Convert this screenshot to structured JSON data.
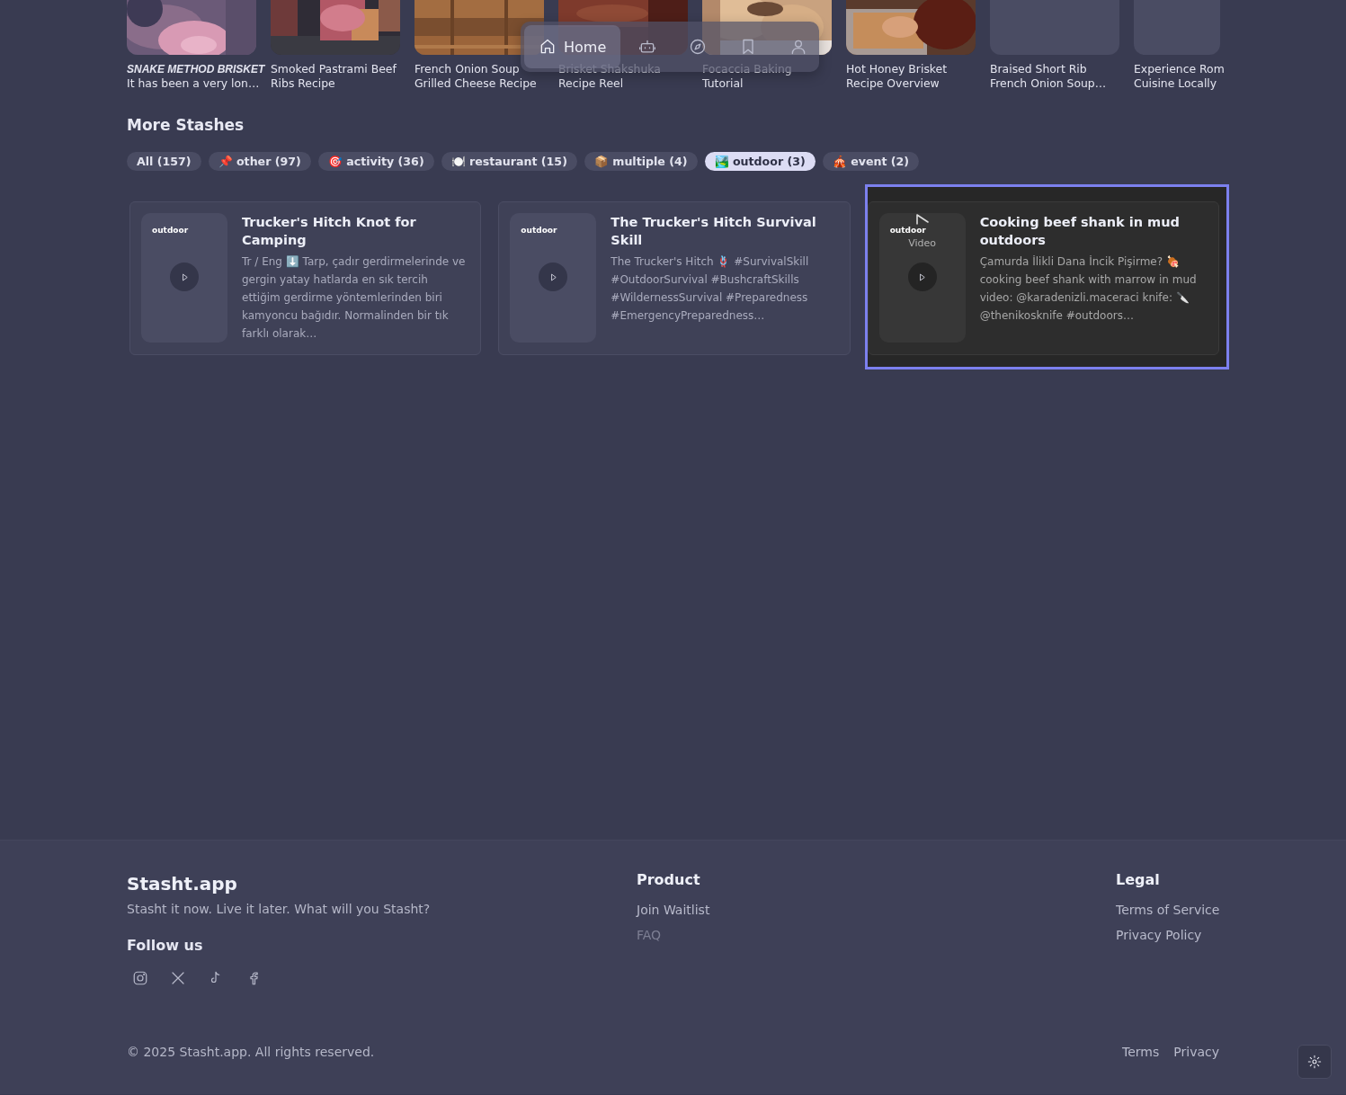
{
  "recent": [
    {
      "kind": "picture",
      "title": "SNAKE METHOD BRISKET",
      "subtitle": "It has been a very lon…"
    },
    {
      "kind": "picture",
      "lines": [
        "Smoked Pastrami Beef",
        "Ribs Recipe"
      ]
    },
    {
      "kind": "picture",
      "lines": [
        "French Onion Soup",
        "Grilled Cheese Recipe"
      ]
    },
    {
      "kind": "picture",
      "lines": [
        "Brisket Shakshuka",
        "Recipe Reel"
      ]
    },
    {
      "kind": "picture",
      "lines": [
        "Focaccia Baking",
        "Tutorial"
      ]
    },
    {
      "kind": "picture",
      "lines": [
        "Hot Honey Brisket",
        "Recipe Overview"
      ]
    },
    {
      "kind": "placeholder",
      "lines": [
        "Braised Short Rib",
        "French Onion Soup…"
      ]
    },
    {
      "kind": "placeholder",
      "lines": [
        "Experience Rom",
        "Cuisine Locally"
      ]
    }
  ],
  "nav": {
    "items": [
      {
        "kind": "home",
        "label": "Home",
        "selected": true
      },
      {
        "kind": "robot",
        "selected": false
      },
      {
        "kind": "compass",
        "selected": false
      },
      {
        "kind": "bookmark",
        "selected": false
      },
      {
        "kind": "user",
        "selected": false
      }
    ]
  },
  "section_title": "More Stashes",
  "filters": [
    {
      "label": "All (157)",
      "selected": false
    },
    {
      "label": "📌 other (97)",
      "selected": false
    },
    {
      "label": "🎯 activity (36)",
      "selected": false
    },
    {
      "label": "🍽️ restaurant (15)",
      "selected": false
    },
    {
      "label": "📦 multiple (4)",
      "selected": false
    },
    {
      "label": "🏞️ outdoor (3)",
      "selected": true
    },
    {
      "label": "🎪 event (2)",
      "selected": false
    }
  ],
  "stashes": [
    {
      "tag": "outdoor",
      "title": "Trucker's Hitch Knot for Camping",
      "description": "Tr / Eng ⬇️ Tarp, çadır gerdirmelerinde ve gergin yatay hatlarda en sık tercih ettiğim gerdirme yöntemlerinden biri kamyoncu bağıdır. Normalinden bir tık farklı olarak…",
      "selected": false
    },
    {
      "tag": "outdoor",
      "title": "The Trucker's Hitch Survival Skill",
      "description": "The Trucker's Hitch 🪢 #SurvivalSkill #OutdoorSurvival #BushcraftSkills #WildernessSurvival #Preparedness #EmergencyPreparedness…",
      "selected": false
    },
    {
      "tag": "outdoor",
      "media_label": "Video",
      "title": "Cooking beef shank in mud outdoors",
      "description": "Çamurda İlikli Dana İncik Pişirme? 🍖 cooking beef shank with marrow in mud video: @karadenizli.maceraci knife: 🔪 @thenikosknife #outdoors…",
      "selected": true
    }
  ],
  "footer": {
    "brand": "Stasht.app",
    "tagline": "Stasht it now. Live it later. What will you Stasht?",
    "follow_title": "Follow us",
    "socials": [
      {
        "kind": "instagram"
      },
      {
        "kind": "x"
      },
      {
        "kind": "tiktok"
      },
      {
        "kind": "facebook"
      }
    ],
    "columns": [
      {
        "title": "Product",
        "links": [
          {
            "label": "Join Waitlist",
            "disabled": false
          },
          {
            "label": "FAQ",
            "disabled": true
          }
        ]
      },
      {
        "title": "Legal",
        "links": [
          {
            "label": "Terms of Service",
            "disabled": false
          },
          {
            "label": "Privacy Policy",
            "disabled": false
          }
        ]
      }
    ],
    "copyright": "© 2025 Stasht.app. All rights reserved.",
    "bottom_links": [
      "Terms",
      "Privacy"
    ]
  }
}
